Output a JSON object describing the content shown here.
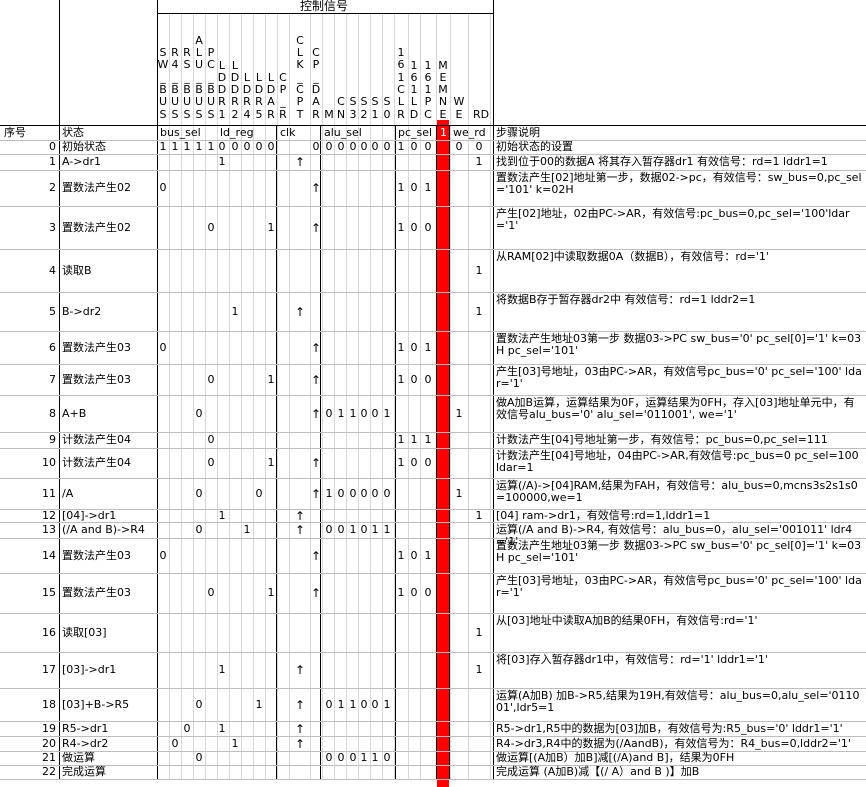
{
  "header": {
    "control_signals_title": "控制信号",
    "col_seq": "序号",
    "col_state": "状态",
    "col_desc": "步骤说明",
    "vertical_signals": [
      {
        "text": "S\nW\n_\nB\nU\nS"
      },
      {
        "text": "R\n4\n_\nB\nU\nS"
      },
      {
        "text": "R\nS\n_\nB\nU\nS"
      },
      {
        "text": "A\nL\nU\n_\nB\nU\nS"
      },
      {
        "text": "P\nC\n_\nB\nU\nS"
      },
      {
        "text": "L\nD\nD\nR\n1"
      },
      {
        "text": "L\nD\nD\nR\n2"
      },
      {
        "text": "L\nD\nR\n4"
      },
      {
        "text": "L\nD\nR\n5"
      },
      {
        "text": "L\nD\nA\nR"
      },
      {
        "text": "C\nP\n_\nR"
      },
      {
        "text": "C\nL\nK\n_\nC\nP\nT"
      },
      {
        "text": "C\nP\n_\nD\nA\nR"
      },
      {
        "text": "M"
      },
      {
        "text": "C\nN"
      },
      {
        "text": "S\n3"
      },
      {
        "text": "S\n2"
      },
      {
        "text": "S\n1"
      },
      {
        "text": "S\n0"
      },
      {
        "text": "1\n6\n1\nC\nL\nR"
      },
      {
        "text": "1\n6\n1\nL\nD"
      },
      {
        "text": "1\n6\n1\nP\nC"
      },
      {
        "text": "M\nE\nM\nN\nE"
      },
      {
        "text": "W\nE"
      },
      {
        "text": "RD"
      }
    ],
    "groups": [
      {
        "label": "bus_sel"
      },
      {
        "label": "ld_reg"
      },
      {
        "label": "clk"
      },
      {
        "label": "alu_sel"
      },
      {
        "label": "pc_sel"
      },
      {
        "label": "1"
      },
      {
        "label": "we_rd"
      }
    ]
  },
  "rows": [
    {
      "seq": "0",
      "state": "初始状态",
      "vals": [
        "1",
        "1",
        "1",
        "1",
        "1",
        "0",
        "0",
        "0",
        "0",
        "0",
        "",
        "",
        "0",
        "0",
        "0",
        "0",
        "0",
        "0",
        "0",
        "1",
        "0",
        "0",
        "",
        "0",
        "0"
      ],
      "desc": "初始状态的设置"
    },
    {
      "seq": "1",
      "state": "A->dr1",
      "vals": [
        "",
        "",
        "",
        "",
        "",
        "1",
        "",
        "",
        "",
        "",
        "",
        "↑",
        "",
        "",
        "",
        "",
        "",
        "",
        "",
        "",
        "",
        "",
        "",
        "",
        "1"
      ],
      "desc": "找到位于00的数据A 将其存入暂存器dr1 有效信号：rd=1 lddr1=1"
    },
    {
      "seq": "2",
      "state": "置数法产生02",
      "vals": [
        "0",
        "",
        "",
        "",
        "",
        "",
        "",
        "",
        "",
        "",
        "",
        "",
        "↑",
        "",
        "",
        "",
        "",
        "",
        "",
        "1",
        "0",
        "1",
        "",
        "",
        ""
      ],
      "desc": "置数法产生[02]地址第一步，数据02->pc，有效信号：sw_bus=0,pc_sel='101' k=02H"
    },
    {
      "seq": "3",
      "state": "置数法产生02",
      "vals": [
        "",
        "",
        "",
        "",
        "0",
        "",
        "",
        "",
        "",
        "1",
        "",
        "",
        "↑",
        "",
        "",
        "",
        "",
        "",
        "",
        "1",
        "0",
        "0",
        "",
        "",
        ""
      ],
      "desc": "产生[02]地址，02由PC->AR，有效信号:pc_bus=0,pc_sel='100'ldar='1'"
    },
    {
      "seq": "4",
      "state": "读取B",
      "vals": [
        "",
        "",
        "",
        "",
        "",
        "",
        "",
        "",
        "",
        "",
        "",
        "",
        "",
        "",
        "",
        "",
        "",
        "",
        "",
        "",
        "",
        "",
        "",
        "",
        "1"
      ],
      "desc": "从RAM[02]中读取数据0A（数据B），有效信号：rd='1'"
    },
    {
      "seq": "5",
      "state": "B->dr2",
      "vals": [
        "",
        "",
        "",
        "",
        "",
        "",
        "1",
        "",
        "",
        "",
        "",
        "↑",
        "",
        "",
        "",
        "",
        "",
        "",
        "",
        "",
        "",
        "",
        "",
        "",
        "1"
      ],
      "desc": "将数据B存于暂存器dr2中 有效信号：rd=1 lddr2=1"
    },
    {
      "seq": "6",
      "state": "置数法产生03",
      "vals": [
        "0",
        "",
        "",
        "",
        "",
        "",
        "",
        "",
        "",
        "",
        "",
        "",
        "↑",
        "",
        "",
        "",
        "",
        "",
        "",
        "1",
        "0",
        "1",
        "",
        "",
        ""
      ],
      "desc": "置数法产生地址03第一步 数据03->PC sw_bus='0' pc_sel[0]='1' k=03H pc_sel='101'"
    },
    {
      "seq": "7",
      "state": "置数法产生03",
      "vals": [
        "",
        "",
        "",
        "",
        "0",
        "",
        "",
        "",
        "",
        "1",
        "",
        "",
        "↑",
        "",
        "",
        "",
        "",
        "",
        "",
        "1",
        "0",
        "0",
        "",
        "",
        ""
      ],
      "desc": "产生[03]号地址，03由PC->AR，有效信号pc_bus='0' pc_sel='100' ldar='1'"
    },
    {
      "seq": "8",
      "state": "A+B",
      "vals": [
        "",
        "",
        "",
        "0",
        "",
        "",
        "",
        "",
        "",
        "",
        "",
        "",
        "↑",
        "0",
        "1",
        "1",
        "0",
        "0",
        "1",
        "",
        "",
        "",
        "",
        "1",
        ""
      ],
      "desc": "做A加B运算，运算结果为0F，运算结果为0FH，存入[03]地址单元中，有效信号alu_bus='0' alu_sel='011001', we='1'"
    },
    {
      "seq": "9",
      "state": "计数法产生04",
      "vals": [
        "",
        "",
        "",
        "",
        "0",
        "",
        "",
        "",
        "",
        "",
        "",
        "",
        "",
        "",
        "",
        "",
        "",
        "",
        "",
        "1",
        "1",
        "1",
        "",
        "",
        ""
      ],
      "desc": "计数法产生[04]号地址第一步，有效信号：pc_bus=0,pc_sel=111"
    },
    {
      "seq": "10",
      "state": "计数法产生04",
      "vals": [
        "",
        "",
        "",
        "",
        "0",
        "",
        "",
        "",
        "",
        "1",
        "",
        "",
        "↑",
        "",
        "",
        "",
        "",
        "",
        "",
        "1",
        "0",
        "0",
        "",
        "",
        ""
      ],
      "desc": "计数法产生[04]号地址，04由PC->AR,有效信号:pc_bus=0 pc_sel=100 ldar=1"
    },
    {
      "seq": "11",
      "state": "/A",
      "vals": [
        "",
        "",
        "",
        "0",
        "",
        "",
        "",
        "",
        "0",
        "",
        "",
        "",
        "↑",
        "1",
        "0",
        "0",
        "0",
        "0",
        "0",
        "",
        "",
        "",
        "",
        "1",
        ""
      ],
      "desc": "运算(/A)->[04]RAM,结果为FAH，有效信号：alu_bus=0,mcns3s2s1s0=100000,we=1"
    },
    {
      "seq": "12",
      "state": "[04]->dr1",
      "vals": [
        "",
        "",
        "",
        "",
        "",
        "1",
        "",
        "",
        "",
        "",
        "",
        "↑",
        "",
        "",
        "",
        "",
        "",
        "",
        "",
        "",
        "",
        "",
        "",
        "",
        "1"
      ],
      "desc": "[04] ram->dr1，有效信号:rd=1,lddr1=1"
    },
    {
      "seq": "13",
      "state": "(/A and B)->R4",
      "vals": [
        "",
        "",
        "",
        "0",
        "",
        "",
        "",
        "1",
        "",
        "",
        "",
        "↑",
        "",
        "0",
        "0",
        "1",
        "0",
        "1",
        "1",
        "",
        "",
        "",
        "",
        "",
        ""
      ],
      "desc": "运算(/A and B)->R4, 有效信号：alu_bus=0，alu_sel='001011' ldr4='1'"
    },
    {
      "seq": "14",
      "state": "置数法产生03",
      "vals": [
        "0",
        "",
        "",
        "",
        "",
        "",
        "",
        "",
        "",
        "",
        "",
        "",
        "↑",
        "",
        "",
        "",
        "",
        "",
        "",
        "1",
        "0",
        "1",
        "",
        "",
        ""
      ],
      "desc": "置数法产生地址03第一步 数据03->PC sw_bus='0' pc_sel[0]='1' k=03H pc_sel='101'"
    },
    {
      "seq": "15",
      "state": "置数法产生03",
      "vals": [
        "",
        "",
        "",
        "",
        "0",
        "",
        "",
        "",
        "",
        "1",
        "",
        "",
        "↑",
        "",
        "",
        "",
        "",
        "",
        "",
        "1",
        "0",
        "0",
        "",
        "",
        ""
      ],
      "desc": "产生[03]号地址，03由PC->AR，有效信号pc_bus='0' pc_sel='100' ldar='1'"
    },
    {
      "seq": "16",
      "state": "读取[03]",
      "vals": [
        "",
        "",
        "",
        "",
        "",
        "",
        "",
        "",
        "",
        "",
        "",
        "",
        "",
        "",
        "",
        "",
        "",
        "",
        "",
        "",
        "",
        "",
        "",
        "",
        "1"
      ],
      "desc": "从[03]地址中读取A加B的结果0FH，有效信号:rd='1'"
    },
    {
      "seq": "17",
      "state": "[03]->dr1",
      "vals": [
        "",
        "",
        "",
        "",
        "",
        "1",
        "",
        "",
        "",
        "",
        "",
        "↑",
        "",
        "",
        "",
        "",
        "",
        "",
        "",
        "",
        "",
        "",
        "",
        "",
        "1"
      ],
      "desc": "将[03]存入暂存器dr1中，有效信号：rd='1' lddr1='1'"
    },
    {
      "seq": "18",
      "state": "[03]+B->R5",
      "vals": [
        "",
        "",
        "",
        "0",
        "",
        "",
        "",
        "",
        "1",
        "",
        "",
        "↑",
        "",
        "0",
        "1",
        "1",
        "0",
        "0",
        "1",
        "",
        "",
        "",
        "",
        "",
        ""
      ],
      "desc": "运算(A加B) 加B->R5,结果为19H,有效信号：alu_bus=0,alu_sel='011001',ldr5=1"
    },
    {
      "seq": "19",
      "state": "R5->dr1",
      "vals": [
        "",
        "",
        "0",
        "",
        "",
        "1",
        "",
        "",
        "",
        "",
        "",
        "↑",
        "",
        "",
        "",
        "",
        "",
        "",
        "",
        "",
        "",
        "",
        "",
        "",
        ""
      ],
      "desc": " R5->dr1,R5中的数据为[03]加B，有效信号为:R5_bus='0' lddr1='1'"
    },
    {
      "seq": "20",
      "state": "R4->dr2",
      "vals": [
        "",
        "0",
        "",
        "",
        "",
        "",
        "1",
        "",
        "",
        "",
        "",
        "↑",
        "",
        "",
        "",
        "",
        "",
        "",
        "",
        "",
        "",
        "",
        "",
        "",
        ""
      ],
      "desc": "R4->dr3,R4中的数据为(/AandB)，有效信号为：R4_bus=0,lddr2='1'"
    },
    {
      "seq": "21",
      "state": "做运算",
      "vals": [
        "",
        "",
        "",
        "0",
        "",
        "",
        "",
        "",
        "",
        "",
        "",
        "",
        "",
        "0",
        "0",
        "0",
        "1",
        "1",
        "0",
        "",
        "",
        "",
        "",
        "",
        ""
      ],
      "desc": "做运算[(A加B）加B]减[(/A)and B]，结果为0FH"
    },
    {
      "seq": "22",
      "state": "完成运算",
      "vals": [
        "",
        "",
        "",
        "",
        "",
        "",
        "",
        "",
        "",
        "",
        "",
        "",
        "",
        "",
        "",
        "",
        "",
        "",
        "",
        "",
        "",
        "",
        "",
        "",
        ""
      ],
      "desc": "完成运算 (A加B)减【(/ A）and B )】加B"
    }
  ],
  "colors": {
    "highlight_column": "#ff0000",
    "grid": "#000000",
    "faint_grid": "#d8d8d8"
  }
}
